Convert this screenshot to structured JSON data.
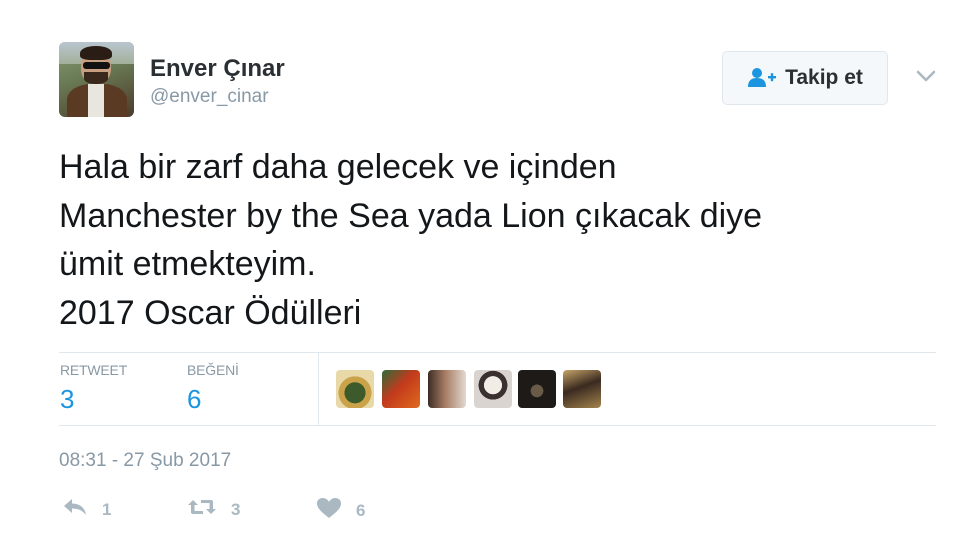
{
  "user": {
    "name": "Enver Çınar",
    "handle": "@enver_cinar",
    "avatar_icon": "user-avatar-photo"
  },
  "follow_button": {
    "label": "Takip et",
    "icon": "person-add-icon",
    "accent": "#1b95e0"
  },
  "menu": {
    "icon": "chevron-down-icon"
  },
  "tweet": {
    "lines": [
      "Hala bir zarf daha gelecek ve içinden",
      "Manchester by the Sea yada Lion çıkacak diye",
      "ümit etmekteyim.",
      "2017 Oscar Ödülleri"
    ]
  },
  "stats": {
    "retweet_label": "RETWEET",
    "retweet_count": "3",
    "like_label": "BEĞENİ",
    "like_count": "6",
    "value_color": "#1b95e0"
  },
  "likers": [
    {
      "name": "liker-avatar-1"
    },
    {
      "name": "liker-avatar-2"
    },
    {
      "name": "liker-avatar-3"
    },
    {
      "name": "liker-avatar-4"
    },
    {
      "name": "liker-avatar-5"
    },
    {
      "name": "liker-avatar-6"
    }
  ],
  "timestamp": "08:31 - 27 Şub 2017",
  "actions": {
    "reply_count": "1",
    "retweet_count": "3",
    "like_count": "6",
    "icon_color": "#aab8c2"
  }
}
